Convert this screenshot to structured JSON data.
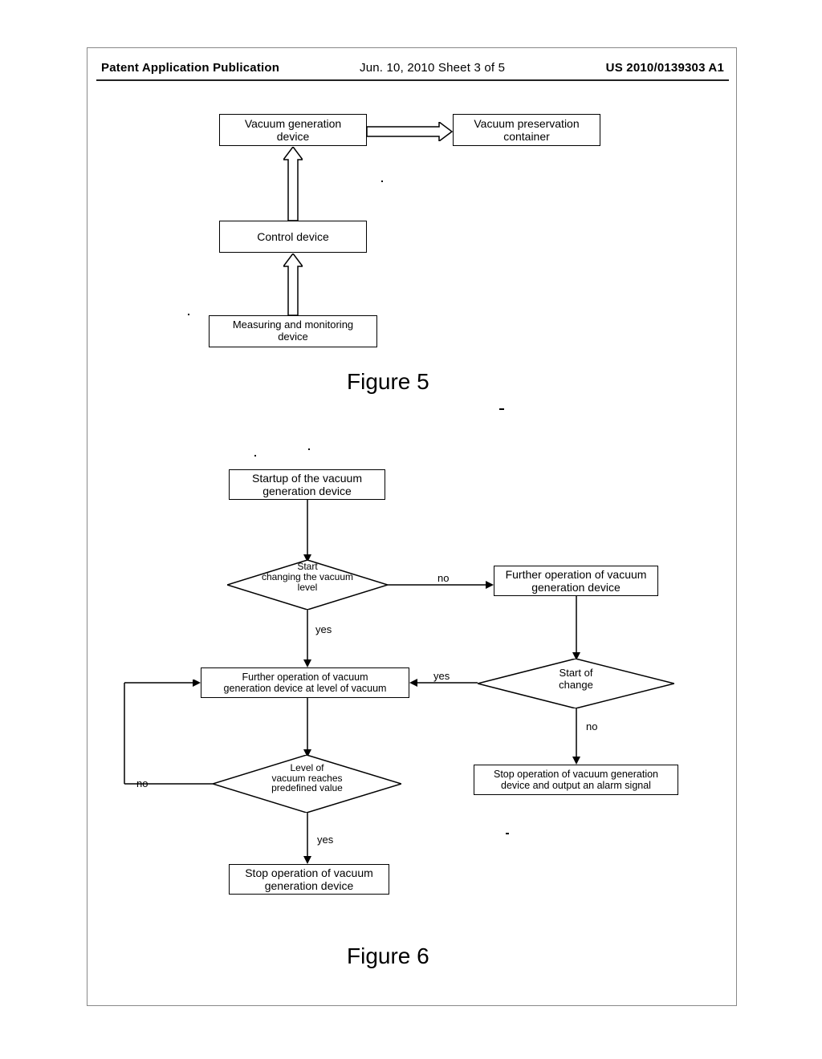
{
  "header": {
    "left": "Patent Application Publication",
    "mid": "Jun. 10, 2010  Sheet 3 of 5",
    "right": "US 2010/0139303 A1"
  },
  "fig5": {
    "label": "Figure 5",
    "box_vgd_l1": "Vacuum generation",
    "box_vgd_l2": "device",
    "box_vpc_l1": "Vacuum preservation",
    "box_vpc_l2": "container",
    "box_ctrl": "Control device",
    "box_mm_l1": "Measuring and monitoring",
    "box_mm_l2": "device"
  },
  "fig6": {
    "label": "Figure 6",
    "start_l1": "Startup of the vacuum",
    "start_l2": "generation device",
    "d1_l1": "Start",
    "d1_l2": "changing the vacuum",
    "d1_l3": "level",
    "d1_yes": "yes",
    "d1_no": "no",
    "further_op_l1": "Further operation of vacuum",
    "further_op_l2": "generation device",
    "d2_l1": "Start of",
    "d2_l2": "change",
    "d2_yes": "yes",
    "d2_no": "no",
    "further_level_l1": "Further operation of vacuum",
    "further_level_l2": "generation device at level of vacuum",
    "d3_l1": "Level of",
    "d3_l2": "vacuum reaches",
    "d3_l3": "predefined value",
    "d3_yes": "yes",
    "d3_no": "no",
    "stop_alarm_l1": "Stop operation of vacuum generation",
    "stop_alarm_l2": "device and output an alarm signal",
    "stop_l1": "Stop operation of vacuum",
    "stop_l2": "generation device"
  }
}
